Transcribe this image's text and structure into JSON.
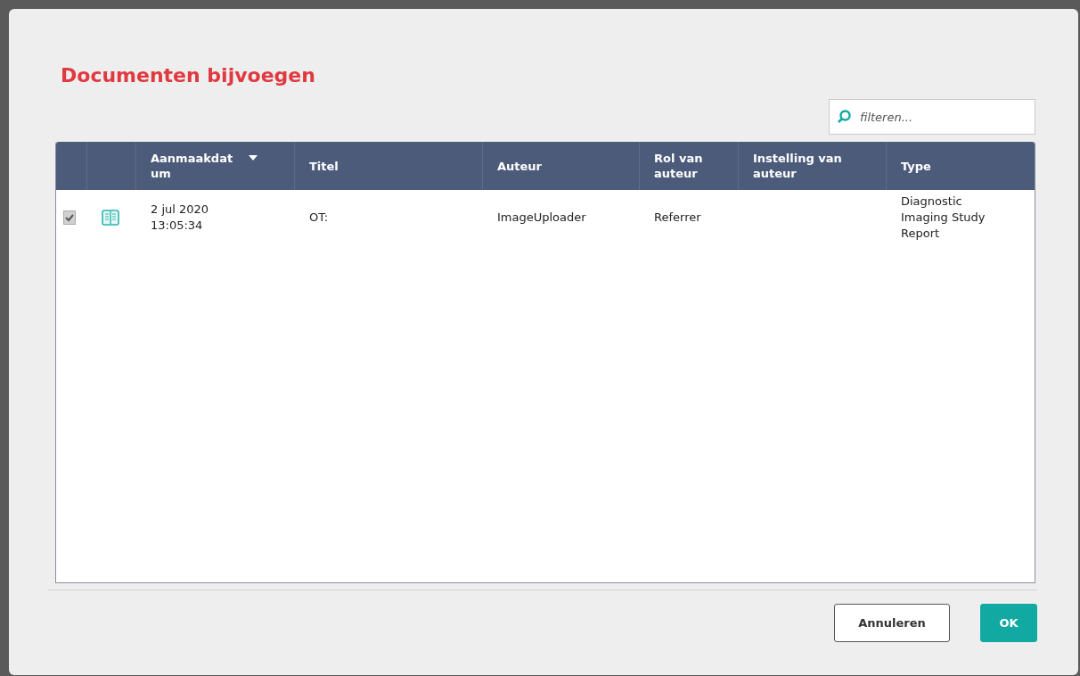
{
  "dialog": {
    "title": "Documenten bijvoegen",
    "filter": {
      "placeholder": "filteren..."
    },
    "table": {
      "columns": [
        {
          "kind": "check"
        },
        {
          "kind": "icon"
        },
        {
          "kind": "text",
          "label": "Aanmaakdatum",
          "sorted": true
        },
        {
          "kind": "text",
          "label": "Titel",
          "sorted": false
        },
        {
          "kind": "text",
          "label": "Auteur",
          "sorted": false
        },
        {
          "kind": "text",
          "label": "Rol van auteur",
          "sorted": false
        },
        {
          "kind": "text",
          "label": "Instelling van auteur",
          "sorted": false
        },
        {
          "kind": "text",
          "label": "Type",
          "sorted": false
        }
      ],
      "rows": [
        {
          "checked": true,
          "created": "2 jul 2020 13:05:34",
          "title": "OT:",
          "author": "ImageUploader",
          "author_role": "Referrer",
          "type": "Diagnostic Imaging Study Report"
        }
      ]
    },
    "buttons": [
      {
        "kind": "secondary",
        "label": "Annuleren"
      },
      {
        "kind": "primary",
        "label": "OK"
      }
    ]
  }
}
